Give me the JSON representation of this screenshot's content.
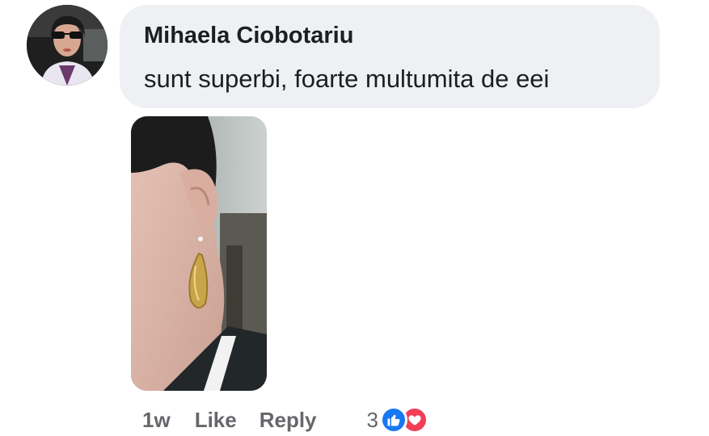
{
  "comment": {
    "author": "Mihaela Ciobotariu",
    "text": "sunt superbi, foarte multumita de eei",
    "timestamp": "1w",
    "like_label": "Like",
    "reply_label": "Reply",
    "reaction_count": "3",
    "reactions": [
      "like-icon",
      "love-icon"
    ]
  },
  "colors": {
    "bubble": "#eef0f4",
    "action_text": "#65676b",
    "like_blue": "#1877f2",
    "love_red": "#f33e58"
  }
}
